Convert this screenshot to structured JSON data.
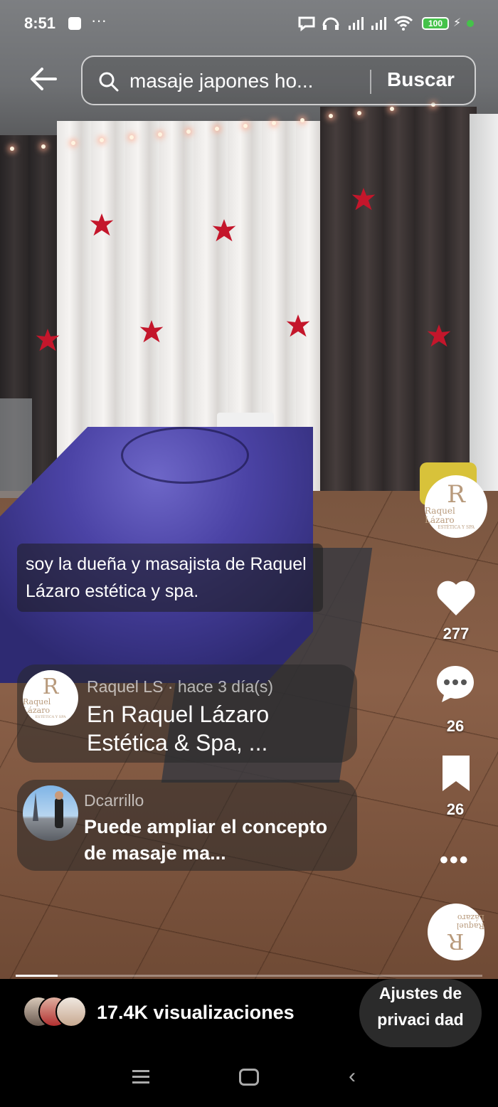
{
  "status_bar": {
    "time": "8:51",
    "battery": "100",
    "icons": [
      "phone-icon",
      "more-icon",
      "chat-icon",
      "headset-icon",
      "signal-icon",
      "signal-icon",
      "wifi-icon",
      "battery-icon",
      "charging-icon"
    ]
  },
  "search": {
    "query": "masaje japones ho...",
    "button_label": "Buscar",
    "icon": "search-icon"
  },
  "caption": {
    "text": "soy la dueña y masajista de Raquel Lázaro estética y spa."
  },
  "rail": {
    "creator_logo_text": "Raquel Lázaro",
    "creator_logo_sub": "ESTÉTICA Y SPA",
    "likes": "277",
    "comments": "26",
    "saves": "26",
    "more_label": "•••"
  },
  "comments": [
    {
      "author": "Raquel LS · hace 3 día(s)",
      "text": "En Raquel Lázaro Estética & Spa, ...",
      "avatar_text": "Raquel Lázaro",
      "avatar_sub": "ESTÉTICA Y SPA"
    },
    {
      "author": "Dcarrillo",
      "text": "Puede ampliar el concepto de masaje ma..."
    }
  ],
  "progress": {
    "fraction": 0.09
  },
  "bottom": {
    "views": "17.4K visualizaciones",
    "privacy_button": "Ajustes de privaci dad"
  },
  "colors": {
    "battery": "#45c24a",
    "logo": "#b89a7c"
  }
}
